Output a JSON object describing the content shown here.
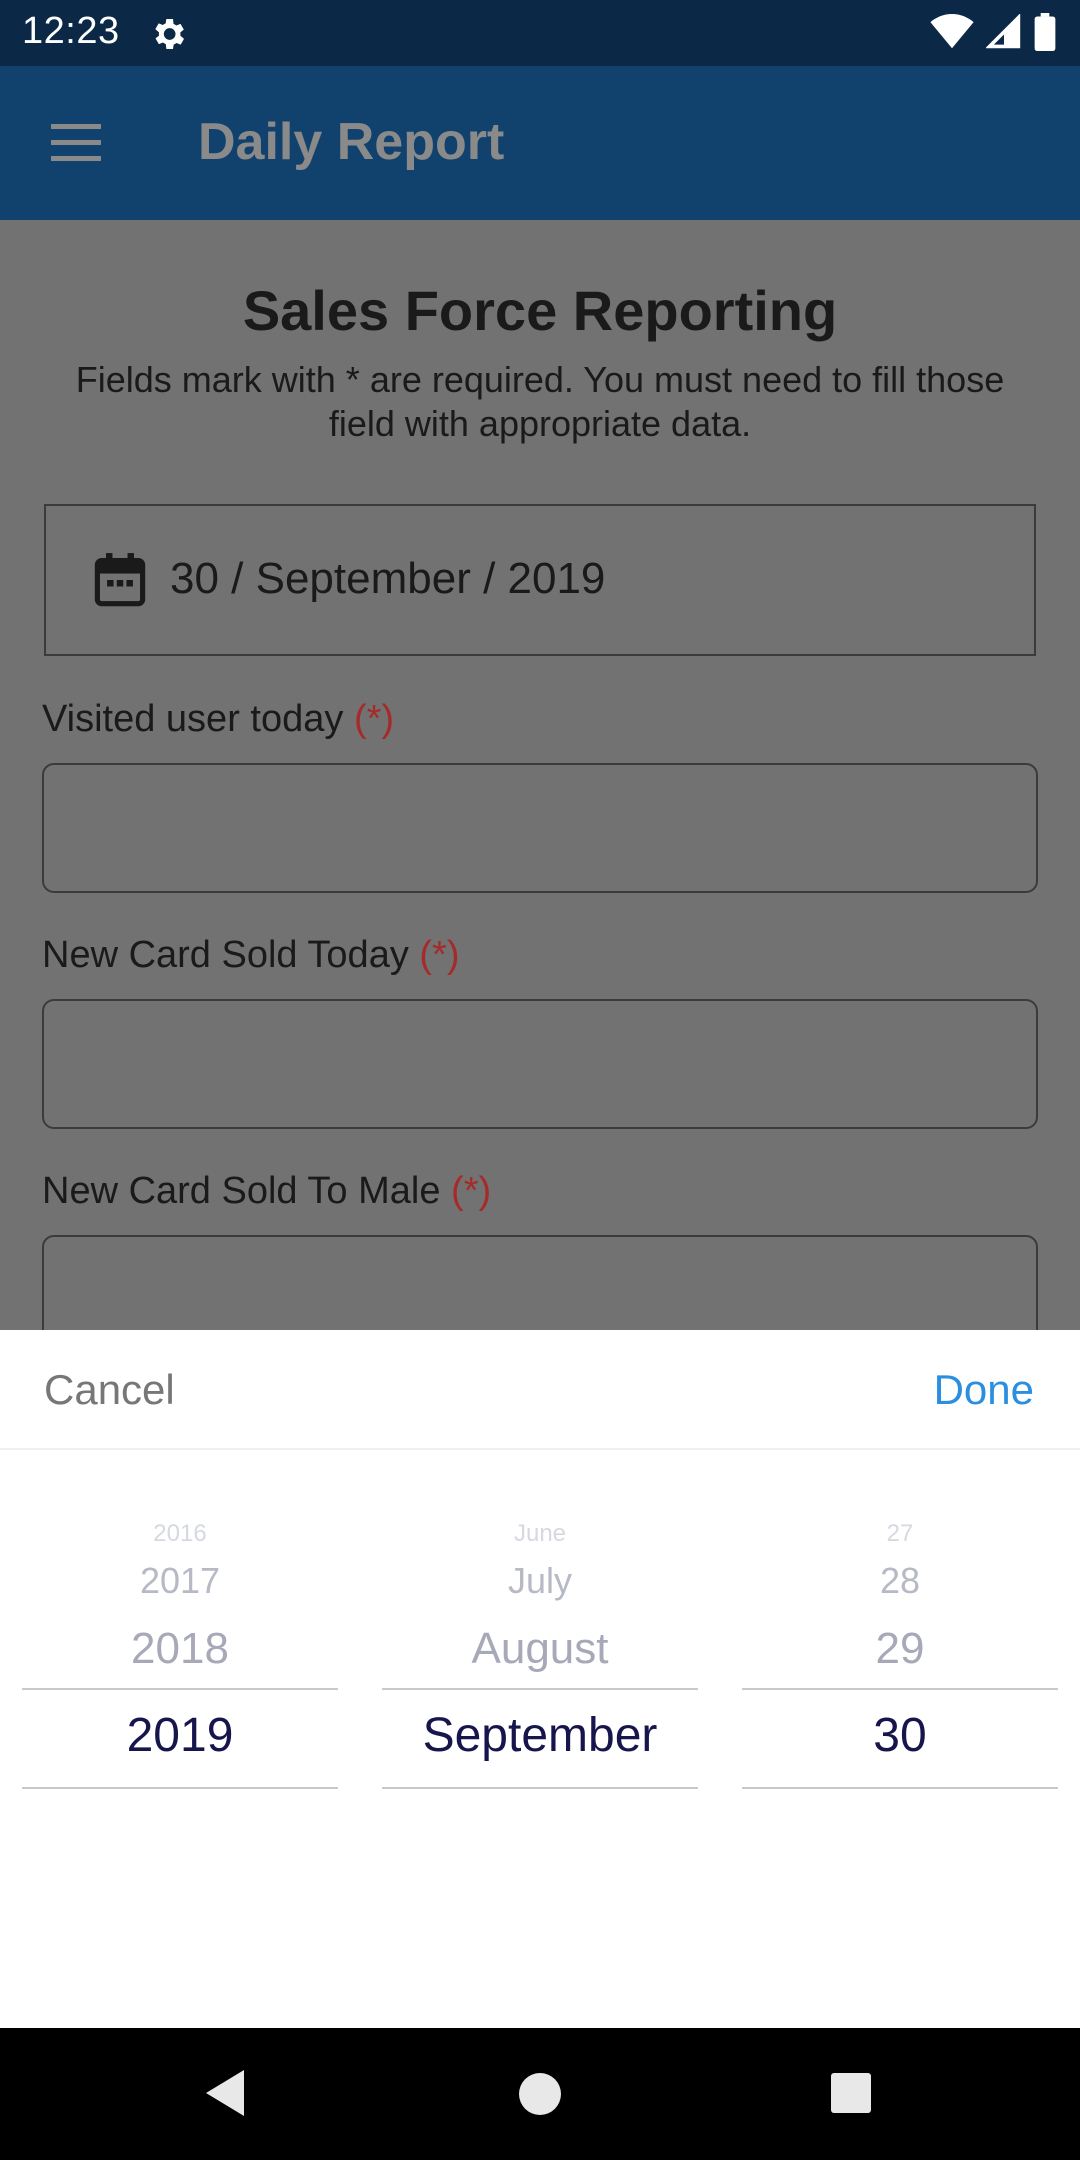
{
  "status_bar": {
    "time": "12:23"
  },
  "app_bar": {
    "title": "Daily Report"
  },
  "form": {
    "heading": "Sales Force Reporting",
    "subtitle": "Fields mark with * are required. You must need to fill those field with appropriate data.",
    "date_value": "30 / September / 2019",
    "required_marker": "(*)",
    "fields": [
      {
        "label": "Visited user today",
        "value": ""
      },
      {
        "label": "New Card Sold Today",
        "value": ""
      },
      {
        "label": "New Card Sold To Male",
        "value": ""
      }
    ]
  },
  "picker": {
    "cancel_label": "Cancel",
    "done_label": "Done",
    "year": {
      "items": [
        "2016",
        "2017",
        "2018"
      ],
      "selected": "2019"
    },
    "month": {
      "items": [
        "June",
        "July",
        "August"
      ],
      "selected": "September"
    },
    "day": {
      "items": [
        "27",
        "28",
        "29"
      ],
      "selected": "30"
    }
  },
  "colors": {
    "status_bar": "#0b2947",
    "app_bar": "#11426e",
    "required": "#a52b2b",
    "done": "#2a8fe0",
    "selected_text": "#16164c"
  }
}
